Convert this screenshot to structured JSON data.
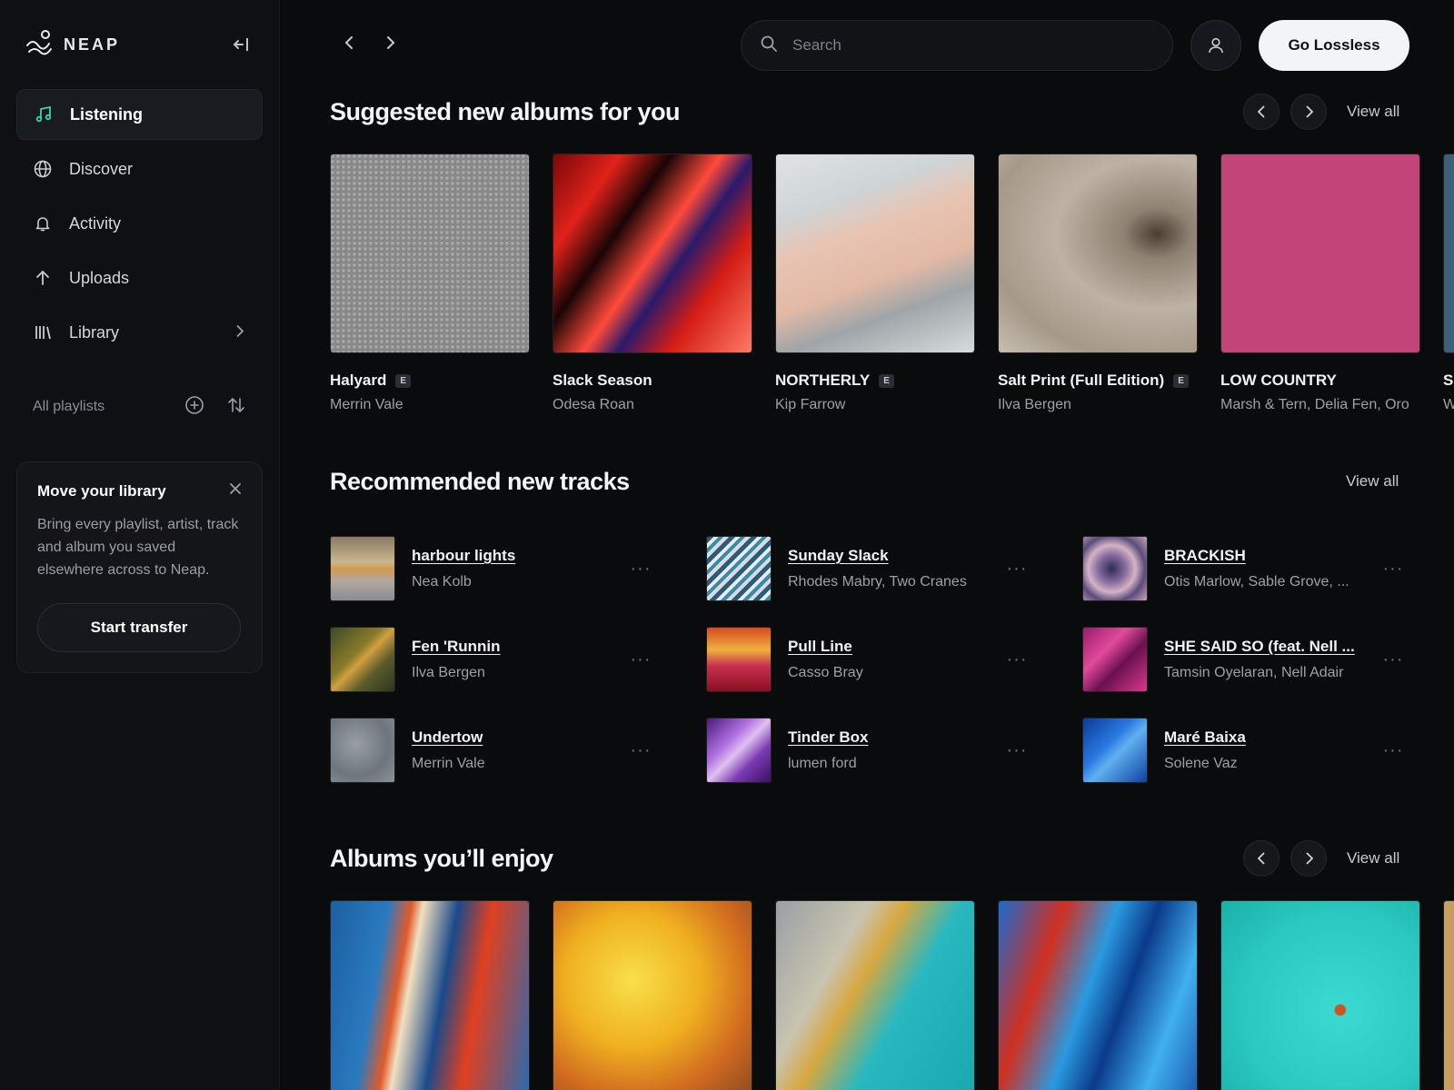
{
  "brand": {
    "name": "NEAP"
  },
  "sidebar": {
    "items": [
      {
        "label": "Listening",
        "icon": "music-note-icon",
        "active": true
      },
      {
        "label": "Discover",
        "icon": "globe-icon"
      },
      {
        "label": "Activity",
        "icon": "bell-icon"
      },
      {
        "label": "Uploads",
        "icon": "arrow-up-icon"
      },
      {
        "label": "Library",
        "icon": "library-icon"
      }
    ],
    "playlists_label": "All playlists",
    "card": {
      "title": "Move your library",
      "body": "Bring every playlist, artist, track and album you saved elsewhere across to Neap.",
      "button": "Start transfer"
    }
  },
  "header": {
    "search_placeholder": "Search",
    "cta": "Go Lossless"
  },
  "colors": {
    "accent": "#3fd1a8",
    "background": "#0a0b0d",
    "sidebar": "#0e1013"
  },
  "sections": {
    "suggested": {
      "title": "Suggested new albums for you",
      "view_all": "View all",
      "albums": [
        {
          "title": "Halyard",
          "explicit": "E",
          "artist": "Merrin Vale"
        },
        {
          "title": "Slack Season",
          "explicit": "",
          "artist": "Odesa Roan"
        },
        {
          "title": "NORTHERLY",
          "explicit": "E",
          "artist": "Kip Farrow"
        },
        {
          "title": "Salt Print (Full Edition)",
          "explicit": "E",
          "artist": "Ilva Bergen"
        },
        {
          "title": "LOW COUNTRY",
          "explicit": "",
          "artist": "Marsh & Tern, Delia Fen, Oro"
        },
        {
          "title": "S",
          "explicit": "",
          "artist": "W"
        }
      ]
    },
    "tracks": {
      "title": "Recommended new tracks",
      "view_all": "View all",
      "items": [
        {
          "title": "harbour lights",
          "artist": "Nea Kolb"
        },
        {
          "title": "Sunday Slack",
          "artist": "Rhodes Mabry, Two Cranes"
        },
        {
          "title": "BRACKISH",
          "artist": "Otis Marlow, Sable Grove, ..."
        },
        {
          "title": "Fen 'Runnin",
          "artist": "Ilva Bergen"
        },
        {
          "title": "Pull Line",
          "artist": "Casso Bray"
        },
        {
          "title": "SHE SAID SO (feat. Nell ...",
          "artist": "Tamsin Oyelaran, Nell Adair"
        },
        {
          "title": "Undertow",
          "artist": "Merrin Vale"
        },
        {
          "title": "Tinder Box",
          "artist": "lumen ford"
        },
        {
          "title": "Maré Baixa",
          "artist": "Solene Vaz"
        }
      ]
    },
    "enjoy": {
      "title": "Albums you’ll enjoy",
      "view_all": "View all"
    }
  }
}
